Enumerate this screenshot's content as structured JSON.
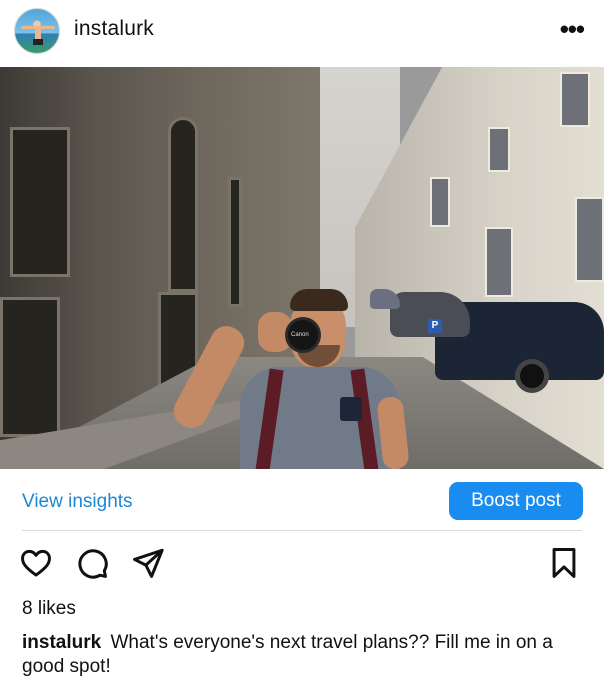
{
  "post": {
    "username": "instalurk",
    "more_label": "•••",
    "photo_label": "Canon",
    "view_insights_label": "View insights",
    "boost_label": "Boost post",
    "likes_text": "8 likes",
    "caption_user": "instalurk",
    "caption_text": "What's everyone's next travel plans?? Fill me in on a good spot!"
  },
  "icons": {
    "like": "heart-icon",
    "comment": "comment-icon",
    "share": "paper-plane-icon",
    "save": "bookmark-icon",
    "more": "more-dots-icon"
  },
  "colors": {
    "link_blue": "#1e87d4",
    "boost_blue": "#1a8cf0",
    "text": "#111111"
  }
}
